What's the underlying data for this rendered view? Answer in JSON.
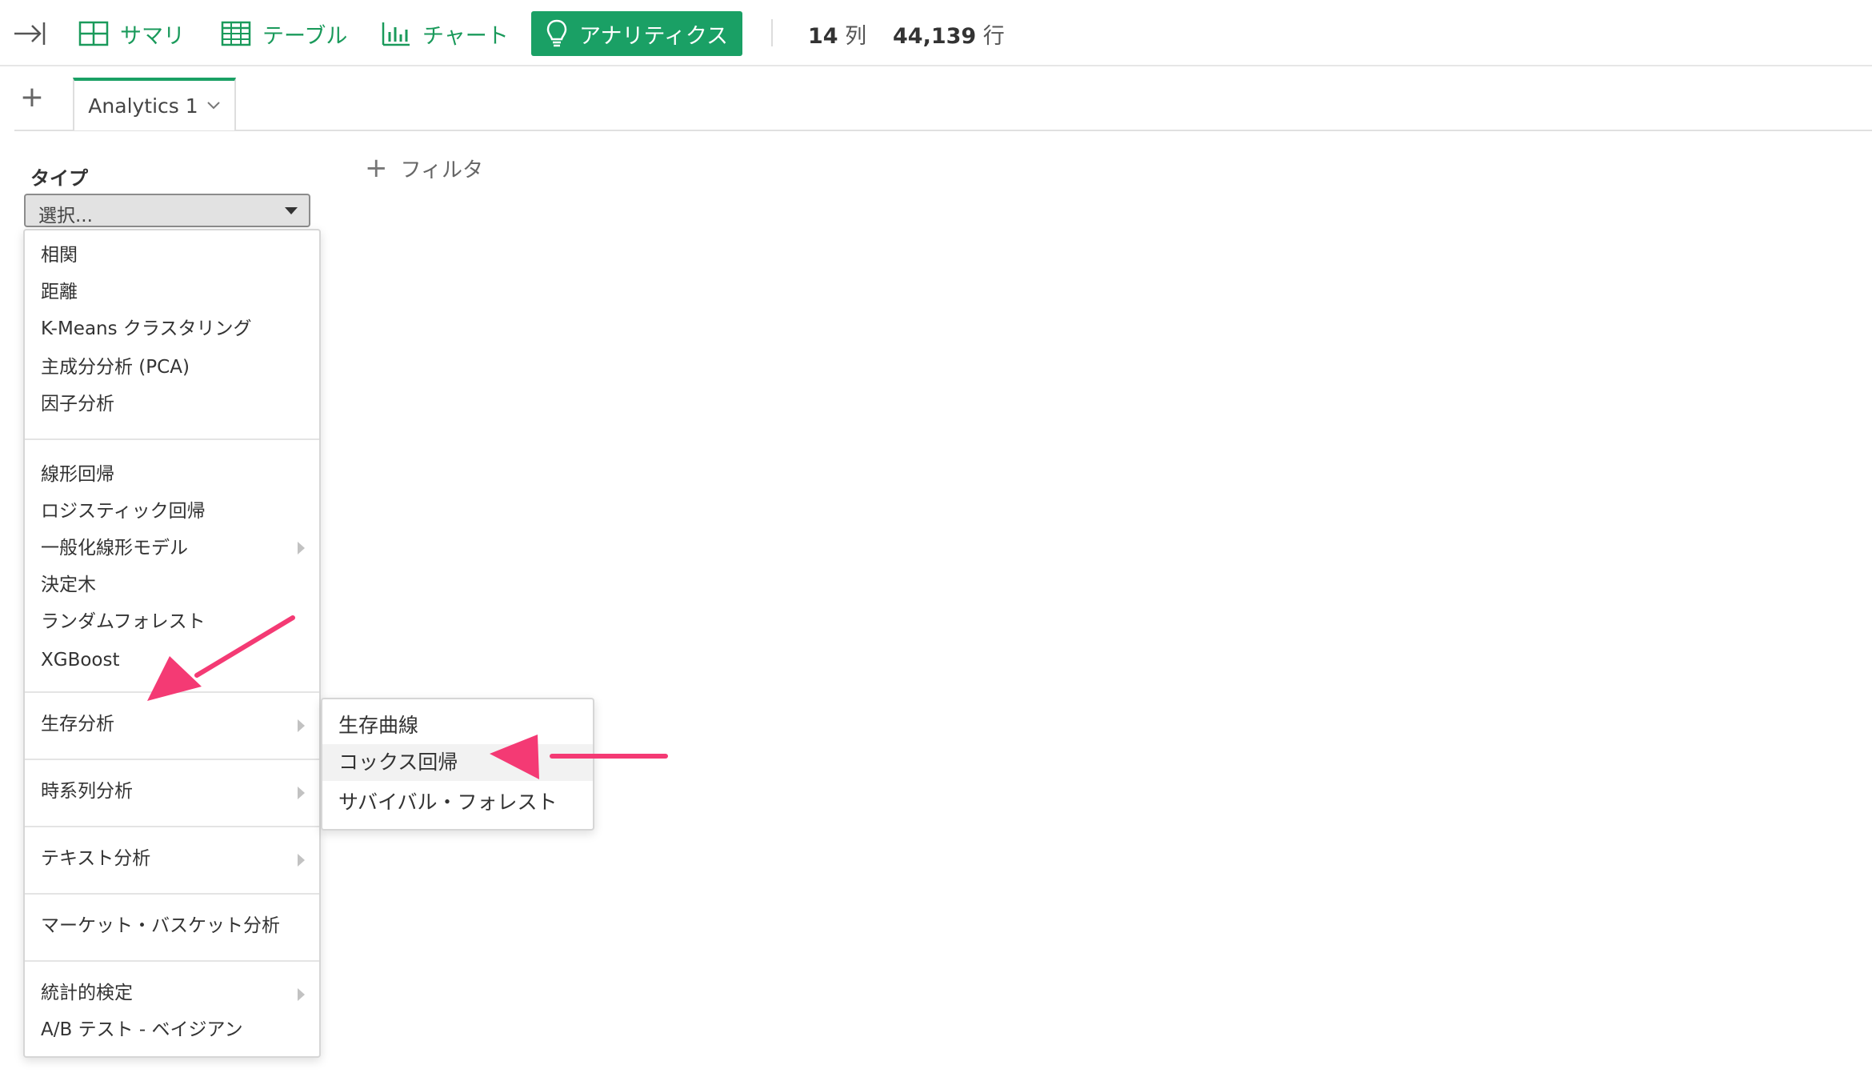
{
  "toolbar": {
    "summary_label": "サマリ",
    "table_label": "テーブル",
    "chart_label": "チャート",
    "analytics_label": "アナリティクス",
    "columns_count": "14",
    "columns_unit": "列",
    "rows_count": "44,139",
    "rows_unit": "行"
  },
  "tabs": {
    "add_label": "+",
    "active_tab": "Analytics 1"
  },
  "panel": {
    "type_label": "タイプ",
    "select_placeholder": "選択...",
    "filter_label": "フィルタ"
  },
  "menu": {
    "groups": [
      {
        "items": [
          "相関",
          "距離",
          "K-Means クラスタリング",
          "主成分分析 (PCA)",
          "因子分析"
        ]
      },
      {
        "items": [
          "線形回帰",
          "ロジスティック回帰",
          "一般化線形モデル",
          "決定木",
          "ランダムフォレスト",
          "XGBoost"
        ]
      },
      {
        "items": [
          "生存分析"
        ]
      },
      {
        "items": [
          "時系列分析"
        ]
      },
      {
        "items": [
          "テキスト分析"
        ]
      },
      {
        "items": [
          "マーケット・バスケット分析"
        ]
      },
      {
        "items": [
          "統計的検定",
          "A/B テスト - ベイジアン"
        ]
      }
    ]
  },
  "submenu": {
    "items": [
      "生存曲線",
      "コックス回帰",
      "サバイバル・フォレスト"
    ],
    "highlighted_item": "コックス回帰"
  },
  "colors": {
    "accent": "#1aa065",
    "annotation_arrow": "#f43a74"
  }
}
